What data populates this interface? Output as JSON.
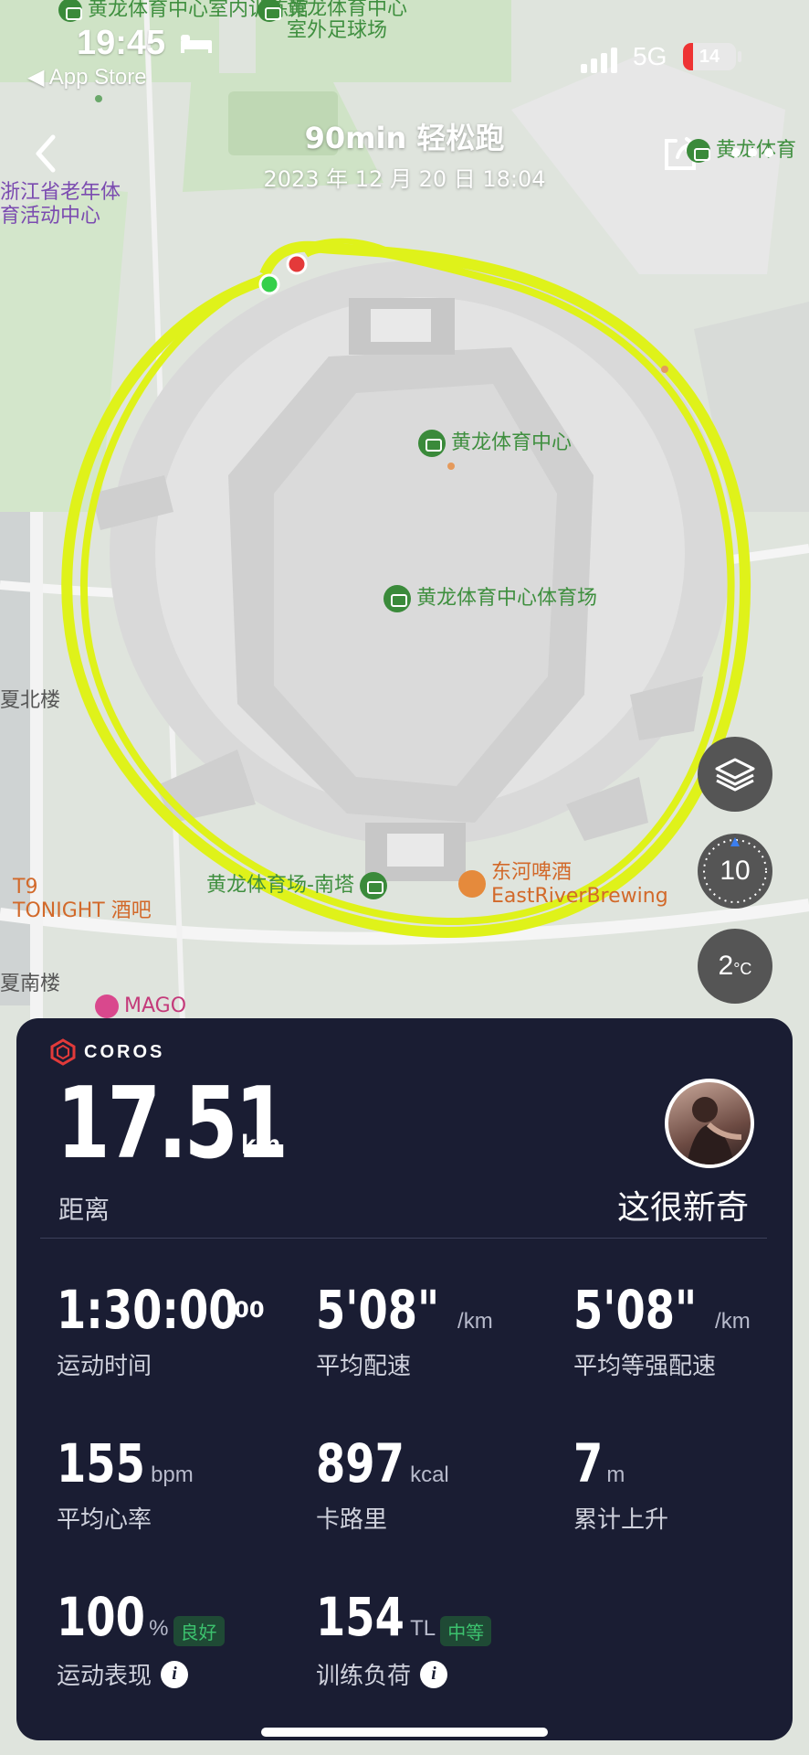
{
  "status_bar": {
    "time": "19:45",
    "back_app": "◀ App Store",
    "network": "5G",
    "battery": 14
  },
  "header": {
    "title": "90min 轻松跑",
    "datetime": "2023 年 12 月 20 日 18:04"
  },
  "map": {
    "labels": {
      "indoor_training": "黄龙体育中心室内训练馆",
      "outdoor_field_l1": "黄龙体育中心",
      "outdoor_field_l2": "室外足球场",
      "elderly_l1": "浙江省老年体",
      "elderly_l2": "育活动中心",
      "sports_center": "黄龙体育中心",
      "stadium": "黄龙体育中心体育场",
      "south_tower": "黄龙体育场-南塔",
      "brewery_l1": "东河啤酒",
      "brewery_l2": "EastRiverBrewing",
      "north_bldg": "夏北楼",
      "t9_l1": "T9",
      "t9_l2": "TONIGHT 酒吧",
      "south_bldg": "夏南楼",
      "mago": "MAGO",
      "top_right": "黄龙体育"
    },
    "compass_value": "10",
    "temperature": "2",
    "temperature_unit": "°C",
    "route_color": "#dff21a"
  },
  "summary": {
    "brand": "COROS",
    "distance": "17.51",
    "distance_unit": "km",
    "distance_label": "距离",
    "user_name": "这很新奇",
    "stats": [
      {
        "value": "1:30:00",
        "sup": "00",
        "unit": "",
        "label": "运动时间"
      },
      {
        "value": "5'08\"",
        "unit": "/km",
        "label": "平均配速"
      },
      {
        "value": "5'08\"",
        "unit": "/km",
        "label": "平均等强配速"
      },
      {
        "value": "155",
        "unit": "bpm",
        "label": "平均心率"
      },
      {
        "value": "897",
        "unit": "kcal",
        "label": "卡路里"
      },
      {
        "value": "7",
        "unit": "m",
        "label": "累计上升"
      },
      {
        "value": "100",
        "unit": "%",
        "badge": "良好",
        "label": "运动表现"
      },
      {
        "value": "154",
        "unit": "TL",
        "badge": "中等",
        "label": "训练负荷"
      }
    ]
  }
}
